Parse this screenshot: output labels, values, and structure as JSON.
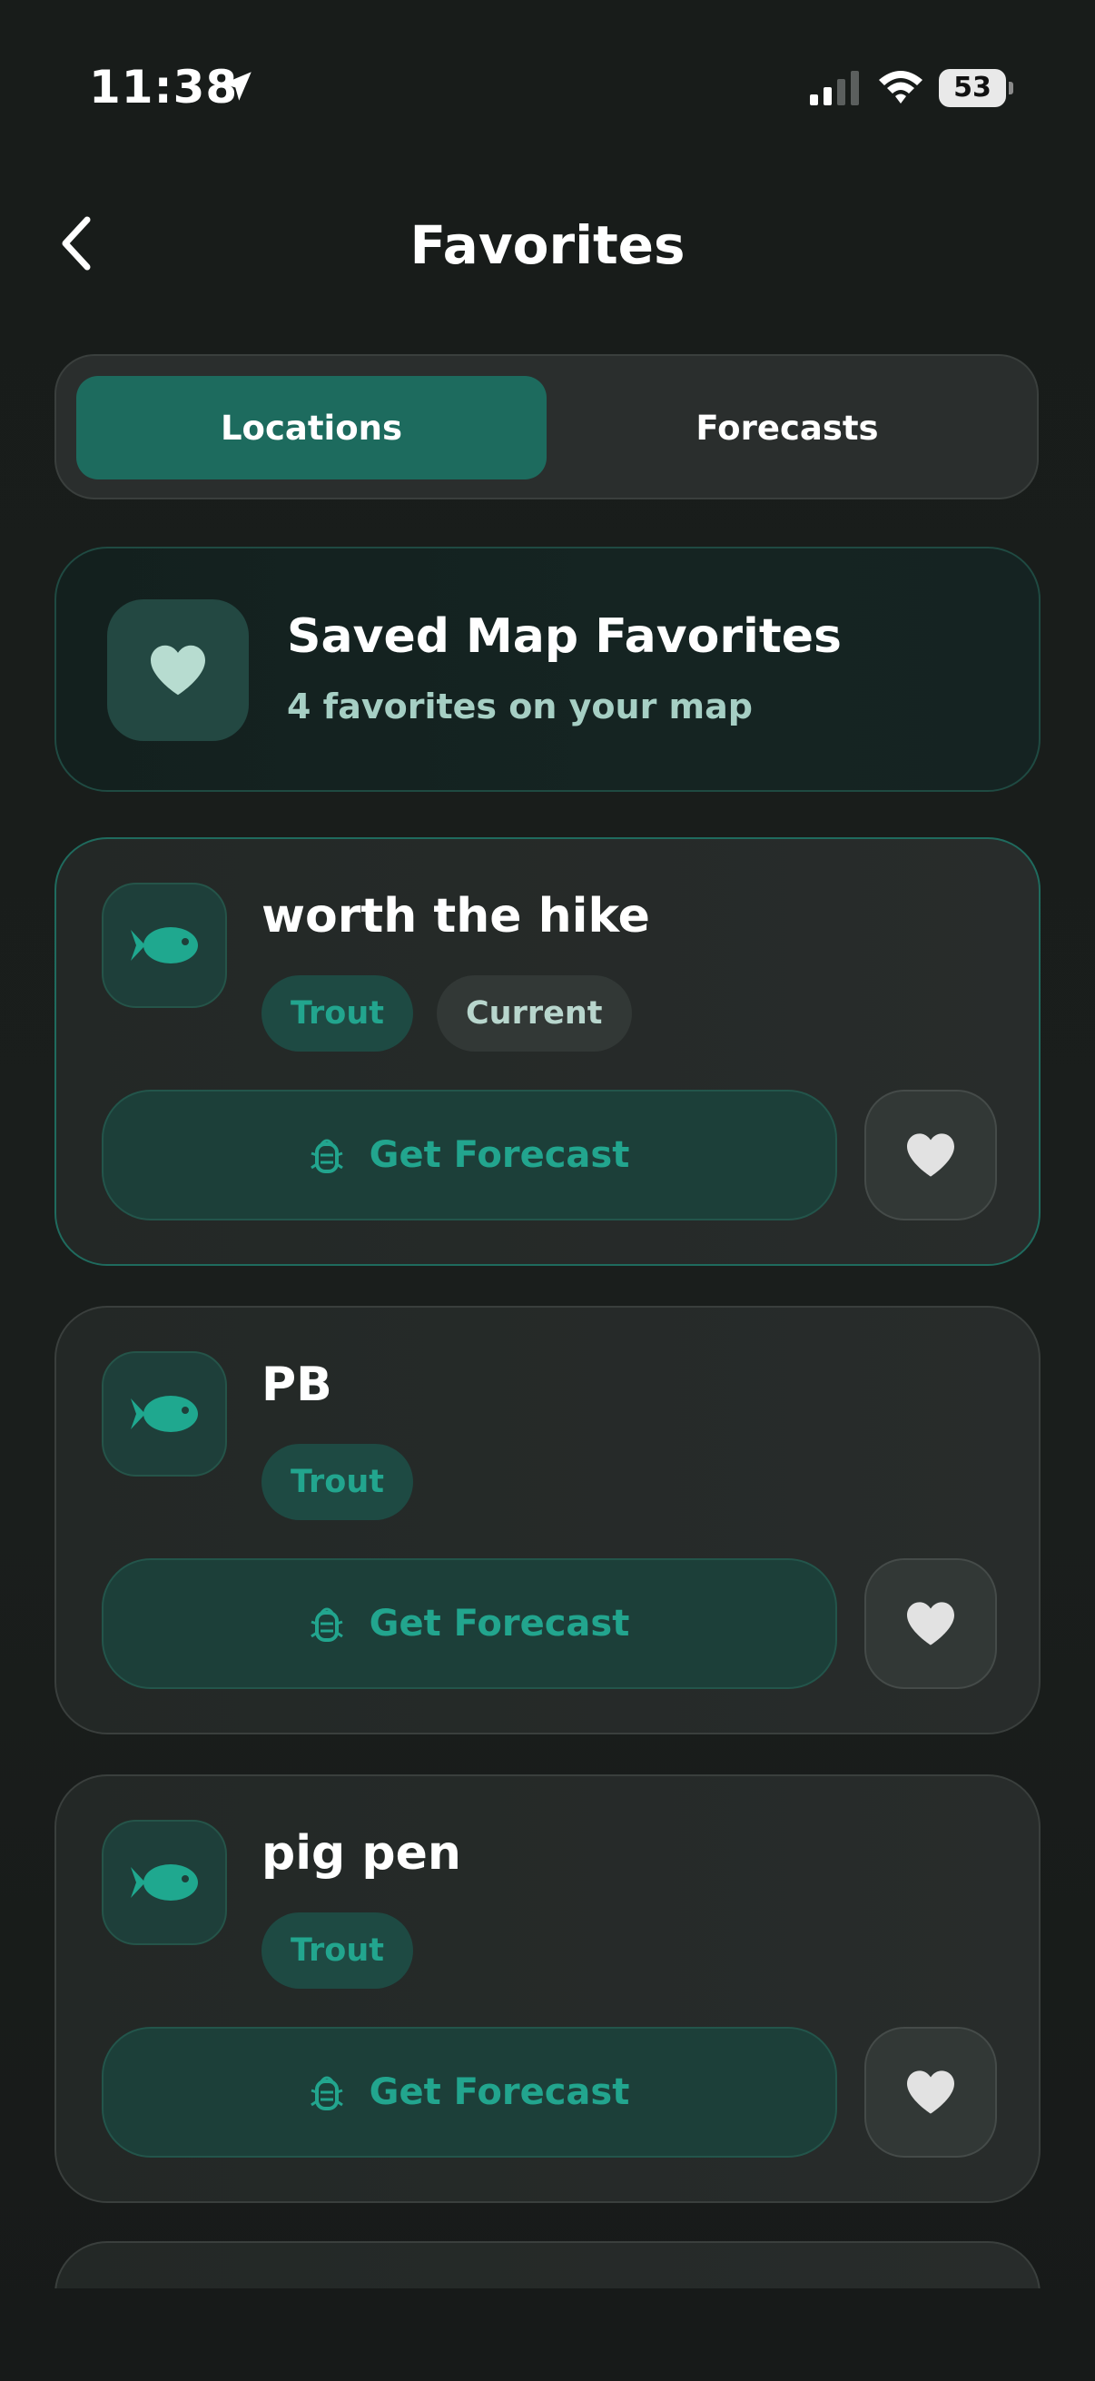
{
  "status_bar": {
    "time": "11:38",
    "battery": "53"
  },
  "header": {
    "title": "Favorites"
  },
  "tabs": [
    {
      "label": "Locations",
      "active": true
    },
    {
      "label": "Forecasts",
      "active": false
    }
  ],
  "summary": {
    "title": "Saved Map Favorites",
    "subtitle": "4 favorites on your map"
  },
  "favorites": [
    {
      "name": "worth the hike",
      "tags": [
        "Trout",
        "Current"
      ],
      "button_label": "Get Forecast"
    },
    {
      "name": "PB",
      "tags": [
        "Trout"
      ],
      "button_label": "Get Forecast"
    },
    {
      "name": "pig pen",
      "tags": [
        "Trout"
      ],
      "button_label": "Get Forecast"
    }
  ],
  "colors": {
    "accent": "#22a58e",
    "active_tab": "#1d6b5e",
    "background": "#181c1a"
  },
  "icons": {
    "back": "chevron-left-icon",
    "summary": "heart-icon",
    "location": "fish-icon",
    "forecast": "bug-icon",
    "favorite": "heart-icon"
  }
}
